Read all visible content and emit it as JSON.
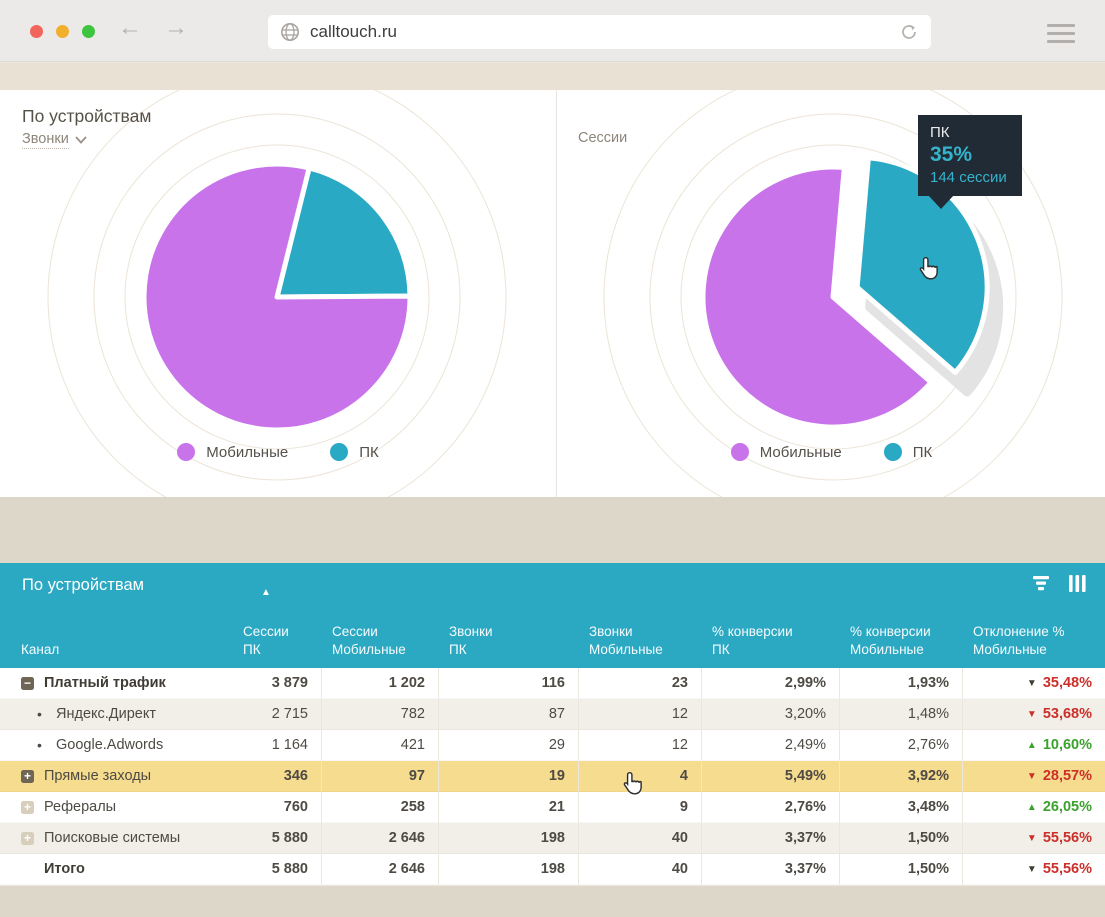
{
  "browser": {
    "url": "calltouch.ru",
    "icons": [
      "globe-icon",
      "refresh-icon",
      "back-arrow-icon",
      "forward-arrow-icon",
      "menu-icon"
    ],
    "traffic_lights": [
      "#f2655c",
      "#f0b02e",
      "#3ec43f"
    ]
  },
  "charts_section": {
    "title": "По устройствам",
    "metric_selector": {
      "label": "Звонки"
    },
    "right_chart_label": "Сессии",
    "legend": [
      {
        "label": "Мобильные",
        "color": "#c873e9"
      },
      {
        "label": "ПК",
        "color": "#2aa9c4"
      }
    ],
    "tooltip": {
      "title": "ПК",
      "percent": "35%",
      "detail": "144 сессии"
    }
  },
  "chart_data": [
    {
      "type": "pie",
      "title": "По устройствам",
      "metric": "Звонки",
      "slices": [
        {
          "label": "ПК",
          "value": 21,
          "color": "#2aa9c4"
        },
        {
          "label": "Мобильные",
          "value": 79,
          "color": "#c873e9"
        }
      ],
      "legend_position": "bottom"
    },
    {
      "type": "pie",
      "title": "Сессии",
      "slices": [
        {
          "label": "ПК",
          "value": 35,
          "color": "#2aa9c4",
          "exploded": true,
          "sessions": 144
        },
        {
          "label": "Мобильные",
          "value": 65,
          "color": "#c873e9"
        }
      ],
      "tooltip": {
        "label": "ПК",
        "percent": "35%",
        "detail": "144 сессии"
      },
      "legend_position": "bottom"
    }
  ],
  "table": {
    "title": "По устройствам",
    "sorted_column": "Сессии ПК",
    "sort_direction": "asc",
    "columns": [
      {
        "line1": "Канал",
        "line2": ""
      },
      {
        "line1": "Сессии",
        "line2": "ПК"
      },
      {
        "line1": "Сессии",
        "line2": "Мобильные"
      },
      {
        "line1": "Звонки",
        "line2": "ПК"
      },
      {
        "line1": "Звонки",
        "line2": "Мобильные"
      },
      {
        "line1": "% конверсии",
        "line2": "ПК"
      },
      {
        "line1": "% конверсии",
        "line2": "Мобильные"
      },
      {
        "line1": "Отклонение %",
        "line2": "Мобильные"
      }
    ],
    "rows": [
      {
        "icon": "minus-dark",
        "label": "Платный трафик",
        "bold": true,
        "style": "normal",
        "values": [
          "3 879",
          "1 202",
          "116",
          "23",
          "2,99%",
          "1,93%"
        ],
        "deviation": {
          "dir": "down",
          "value": "35,48%"
        }
      },
      {
        "icon": "bullet",
        "label": "Яндекс.Директ",
        "bold": false,
        "style": "alt",
        "values": [
          "2 715",
          "782",
          "87",
          "12",
          "3,20%",
          "1,48%"
        ],
        "deviation": {
          "dir": "down",
          "value": "53,68%"
        }
      },
      {
        "icon": "bullet",
        "label": "Google.Adwords",
        "bold": false,
        "style": "normal",
        "values": [
          "1 164",
          "421",
          "29",
          "12",
          "2,49%",
          "2,76%"
        ],
        "deviation": {
          "dir": "up",
          "value": "10,60%"
        }
      },
      {
        "icon": "plus-dark",
        "label": "Прямые заходы",
        "bold": false,
        "style": "highlight",
        "values": [
          "346",
          "97",
          "19",
          "4",
          "5,49%",
          "3,92%"
        ],
        "deviation": {
          "dir": "down",
          "value": "28,57%"
        }
      },
      {
        "icon": "plus-light",
        "label": "Рефералы",
        "bold": false,
        "style": "normal",
        "values": [
          "760",
          "258",
          "21",
          "9",
          "2,76%",
          "3,48%"
        ],
        "deviation": {
          "dir": "up",
          "value": "26,05%"
        }
      },
      {
        "icon": "plus-light",
        "label": "Поисковые системы",
        "bold": false,
        "style": "alt",
        "values": [
          "5 880",
          "2 646",
          "198",
          "40",
          "3,37%",
          "1,50%"
        ],
        "deviation": {
          "dir": "down",
          "value": "55,56%"
        }
      },
      {
        "icon": "none",
        "label": "Итого",
        "bold": true,
        "style": "normal",
        "values": [
          "5 880",
          "2 646",
          "198",
          "40",
          "3,37%",
          "1,50%"
        ],
        "deviation": {
          "dir": "down",
          "value": "55,56%"
        }
      }
    ]
  }
}
